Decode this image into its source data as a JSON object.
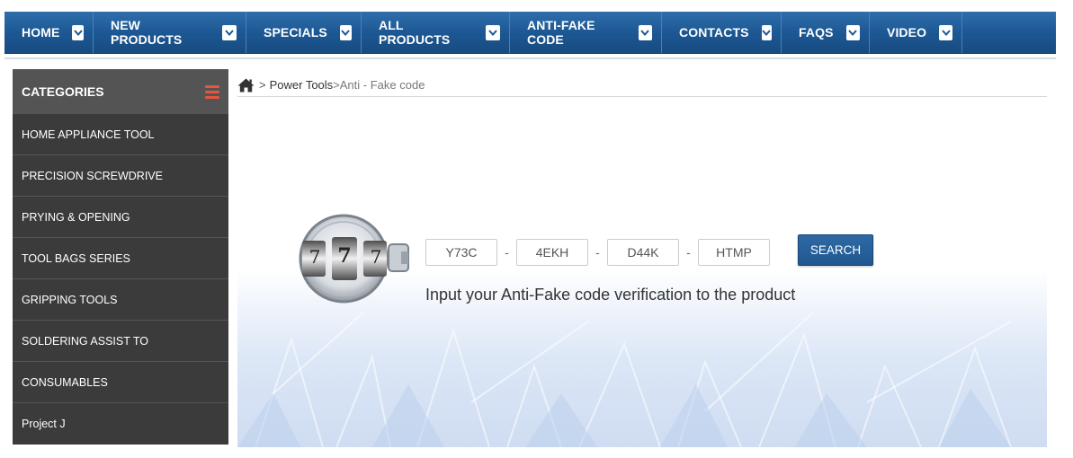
{
  "nav": {
    "items": [
      {
        "label": "HOME"
      },
      {
        "label": "NEW PRODUCTS"
      },
      {
        "label": "SPECIALS"
      },
      {
        "label": "ALL PRODUCTS"
      },
      {
        "label": "ANTI-FAKE CODE"
      },
      {
        "label": "CONTACTS"
      },
      {
        "label": "FAQS"
      },
      {
        "label": "VIDEO"
      }
    ],
    "caret_icon": "chevron-down-icon",
    "bg_color": "#1d5894"
  },
  "sidebar": {
    "title": "CATEGORIES",
    "menu_icon": "hamburger-icon",
    "accent_color": "#e9543a",
    "items": [
      {
        "label": "HOME APPLIANCE TOOL"
      },
      {
        "label": "PRECISION SCREWDRIVE"
      },
      {
        "label": "PRYING & OPENING"
      },
      {
        "label": "TOOL BAGS SERIES"
      },
      {
        "label": "GRIPPING TOOLS"
      },
      {
        "label": "SOLDERING ASSIST TO"
      },
      {
        "label": "CONSUMABLES"
      },
      {
        "label": "Project J"
      }
    ]
  },
  "breadcrumb": {
    "home_icon": "home-icon",
    "separator": ">",
    "parent": "Power Tools",
    "current": ">Anti - Fake code"
  },
  "antifake": {
    "codes": [
      "Y73C",
      "4EKH",
      "D44K",
      "HTMP"
    ],
    "dash": "-",
    "search_label": "SEARCH",
    "hint": "Input your Anti-Fake code verification to the product",
    "lock_digits": [
      "7",
      "7",
      "7"
    ],
    "lock_icon": "combination-lock-icon"
  }
}
